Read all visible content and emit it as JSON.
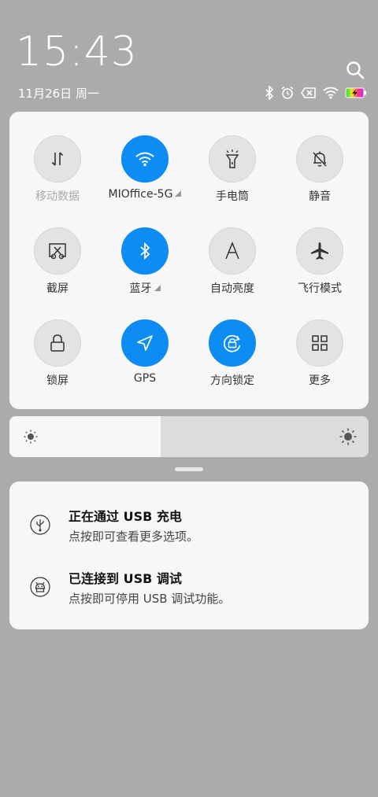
{
  "header": {
    "time": "15:43",
    "date": "11月26日 周一"
  },
  "status_icons": [
    "bluetooth-icon",
    "alarm-icon",
    "no-sim-icon",
    "wifi-icon",
    "battery-charging-icon"
  ],
  "quick_settings": {
    "tiles": [
      {
        "label": "移动数据",
        "icon": "mobile-data-icon",
        "active": false,
        "disabled": true
      },
      {
        "label": "MIOffice-5G",
        "icon": "wifi-icon",
        "active": true,
        "expandable": true
      },
      {
        "label": "手电筒",
        "icon": "flashlight-icon",
        "active": false
      },
      {
        "label": "静音",
        "icon": "mute-bell-icon",
        "active": false
      },
      {
        "label": "截屏",
        "icon": "screenshot-icon",
        "active": false
      },
      {
        "label": "蓝牙",
        "icon": "bluetooth-icon",
        "active": true,
        "expandable": true
      },
      {
        "label": "自动亮度",
        "icon": "auto-brightness-icon",
        "active": false
      },
      {
        "label": "飞行模式",
        "icon": "airplane-icon",
        "active": false
      },
      {
        "label": "锁屏",
        "icon": "lock-icon",
        "active": false
      },
      {
        "label": "GPS",
        "icon": "gps-icon",
        "active": true
      },
      {
        "label": "方向锁定",
        "icon": "rotation-lock-icon",
        "active": true
      },
      {
        "label": "更多",
        "icon": "grid-icon",
        "active": false
      }
    ]
  },
  "brightness": {
    "level": 0.42
  },
  "notifications": [
    {
      "title": "正在通过 USB 充电",
      "text": "点按即可查看更多选项。",
      "icon": "usb-charging-icon"
    },
    {
      "title": "已连接到 USB 调试",
      "text": "点按即可停用 USB 调试功能。",
      "icon": "android-debug-icon"
    }
  ],
  "colors": {
    "accent": "#0d8cf3",
    "background": "#ababab",
    "panel": "#f7f7f7"
  }
}
